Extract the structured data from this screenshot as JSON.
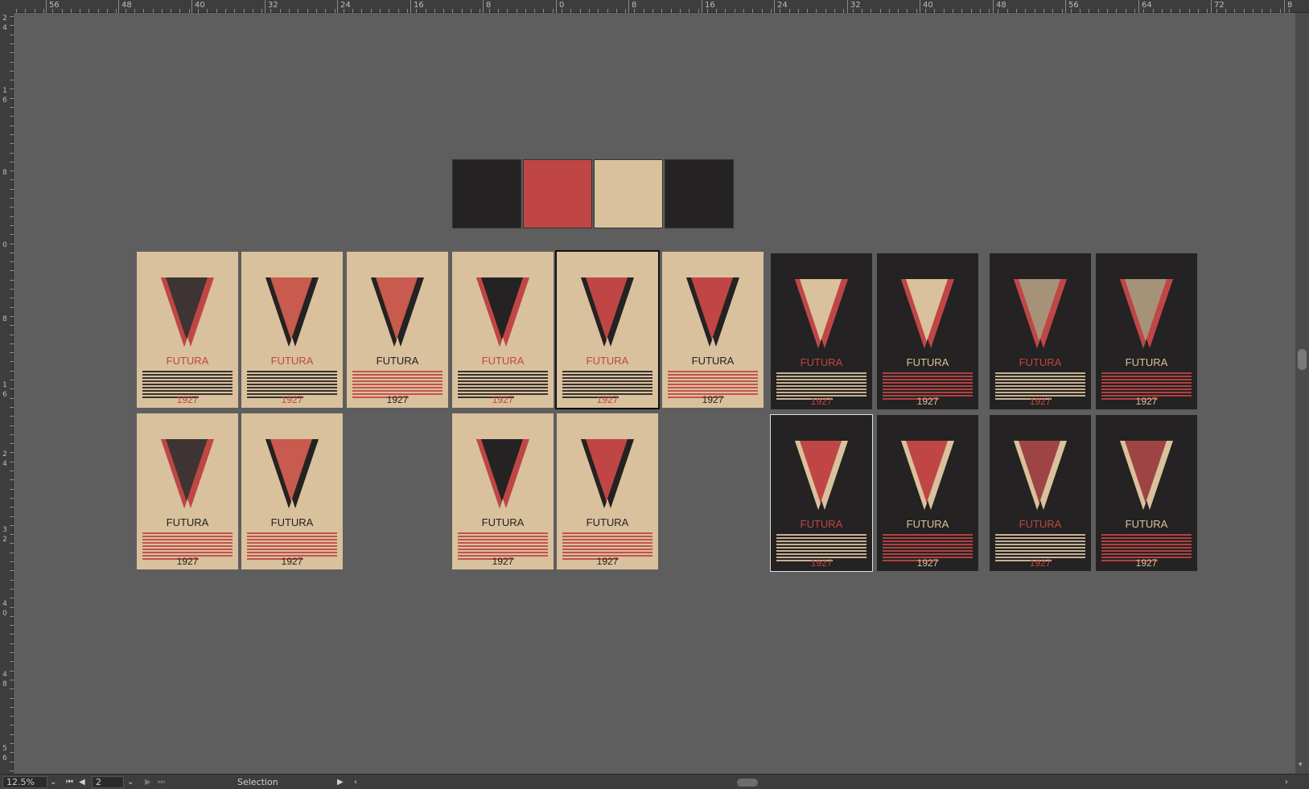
{
  "ruler": {
    "top_labels": [
      "56",
      "48",
      "40",
      "32",
      "24",
      "16",
      "8",
      "0",
      "8",
      "16",
      "24",
      "32",
      "40",
      "48",
      "56",
      "64",
      "72",
      "8"
    ],
    "left_labels": [
      "2",
      "4",
      "1",
      "6",
      "8",
      "0",
      "8",
      "1",
      "6",
      "2",
      "4",
      "3",
      "2",
      "4",
      "0",
      "4",
      "8",
      "5",
      "6"
    ]
  },
  "swatches": {
    "colors": [
      "#242222",
      "#c04646",
      "#d9c19d",
      "#242222"
    ]
  },
  "colors": {
    "cream": "#d9c19d",
    "red": "#c04646",
    "dark": "#242222",
    "canvas": "#5e5e5e"
  },
  "posters": [
    {
      "bg": "cream",
      "main": "#3d3433",
      "offset": "red",
      "title": "FUTURA",
      "title_color": "red",
      "text_color": "dark",
      "year": "1927",
      "year_color": "red"
    },
    {
      "bg": "cream",
      "main": "#c85a4e",
      "offset": "dark",
      "title": "FUTURA",
      "title_color": "red",
      "text_color": "dark",
      "year": "1927",
      "year_color": "red"
    },
    {
      "bg": "cream",
      "main": "#c85a4e",
      "offset": "dark",
      "title": "FUTURA",
      "title_color": "dark",
      "text_color": "red",
      "year": "1927",
      "year_color": "dark"
    },
    {
      "bg": "cream",
      "main": "#242222",
      "offset": "red",
      "title": "FUTURA",
      "title_color": "red",
      "text_color": "dark",
      "year": "1927",
      "year_color": "red"
    },
    {
      "bg": "cream",
      "main": "#c04646",
      "offset": "dark",
      "title": "FUTURA",
      "title_color": "red",
      "text_color": "dark",
      "year": "1927",
      "year_color": "red",
      "selected": true
    },
    {
      "bg": "cream",
      "main": "#c04646",
      "offset": "dark",
      "title": "FUTURA",
      "title_color": "dark",
      "text_color": "red",
      "year": "1927",
      "year_color": "dark"
    },
    {
      "bg": "dark",
      "main": "#d9c19d",
      "offset": "red",
      "title": "FUTURA",
      "title_color": "red",
      "text_color": "cream",
      "year": "1927",
      "year_color": "red"
    },
    {
      "bg": "dark",
      "main": "#d9c19d",
      "offset": "red",
      "title": "FUTURA",
      "title_color": "cream",
      "text_color": "red",
      "year": "1927",
      "year_color": "cream"
    },
    {
      "bg": "dark",
      "main": "#a69278",
      "offset": "red",
      "title": "FUTURA",
      "title_color": "red",
      "text_color": "cream",
      "year": "1927",
      "year_color": "red"
    },
    {
      "bg": "dark",
      "main": "#a69278",
      "offset": "red",
      "title": "FUTURA",
      "title_color": "cream",
      "text_color": "red",
      "year": "1927",
      "year_color": "cream"
    },
    {
      "bg": "cream",
      "main": "#3d3433",
      "offset": "red",
      "title": "FUTURA",
      "title_color": "dark",
      "text_color": "red",
      "year": "1927",
      "year_color": "dark"
    },
    {
      "bg": "cream",
      "main": "#c85a4e",
      "offset": "dark",
      "title": "FUTURA",
      "title_color": "dark",
      "text_color": "red",
      "year": "1927",
      "year_color": "dark"
    },
    {
      "bg": "cream",
      "main": "#242222",
      "offset": "red",
      "title": "FUTURA",
      "title_color": "dark",
      "text_color": "red",
      "year": "1927",
      "year_color": "dark"
    },
    {
      "bg": "cream",
      "main": "#c04646",
      "offset": "dark",
      "title": "FUTURA",
      "title_color": "dark",
      "text_color": "red",
      "year": "1927",
      "year_color": "dark"
    },
    {
      "bg": "dark",
      "main": "#c04646",
      "offset": "cream",
      "title": "FUTURA",
      "title_color": "red",
      "text_color": "cream",
      "year": "1927",
      "year_color": "red",
      "selected_light": true
    },
    {
      "bg": "dark",
      "main": "#c04646",
      "offset": "cream",
      "title": "FUTURA",
      "title_color": "cream",
      "text_color": "red",
      "year": "1927",
      "year_color": "cream"
    },
    {
      "bg": "dark",
      "main": "#9e4444",
      "offset": "cream",
      "title": "FUTURA",
      "title_color": "red",
      "text_color": "cream",
      "year": "1927",
      "year_color": "red"
    },
    {
      "bg": "dark",
      "main": "#9e4444",
      "offset": "cream",
      "title": "FUTURA",
      "title_color": "cream",
      "text_color": "red",
      "year": "1927",
      "year_color": "cream"
    }
  ],
  "statusbar": {
    "zoom": "12.5%",
    "page": "2",
    "status": "Selection",
    "first_icon": "first-page-icon",
    "prev_icon": "prev-page-icon",
    "next_icon": "next-page-icon",
    "last_icon": "last-page-icon"
  }
}
